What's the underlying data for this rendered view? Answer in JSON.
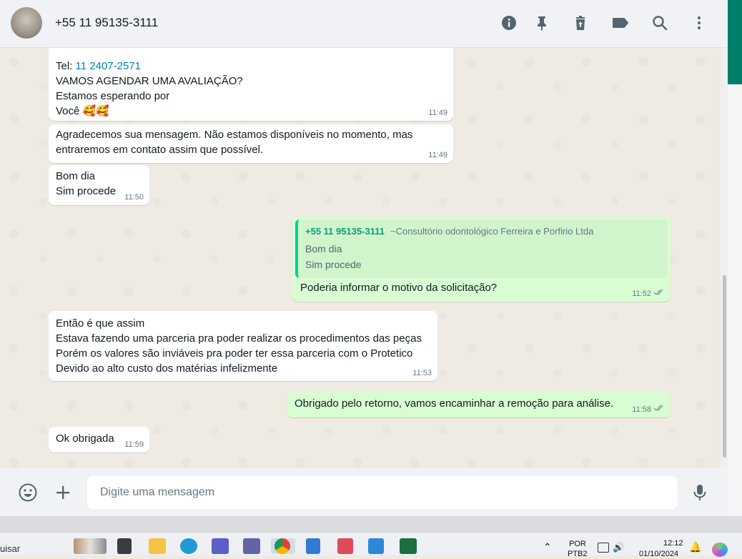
{
  "header": {
    "contact_name": "+55 11 95135-3111",
    "icons": [
      "info-icon",
      "pin-icon",
      "delete-icon",
      "label-icon",
      "search-icon",
      "menu-icon"
    ]
  },
  "messages": [
    {
      "direction": "in",
      "lines": [
        "Tel: ",
        "VAMOS AGENDAR UMA AVALIAÇÃO?",
        "Estamos esperando por",
        "Você 🥰🥰"
      ],
      "phone_link": "11 2407-2571",
      "time": "11:49"
    },
    {
      "direction": "in",
      "lines": [
        "Agradecemos sua mensagem. Não estamos disponíveis no momento, mas",
        "entraremos em contato assim que possível."
      ],
      "time": "11:49"
    },
    {
      "direction": "in",
      "lines": [
        "Bom dia",
        "Sim procede"
      ],
      "time": "11:50"
    },
    {
      "direction": "out",
      "quote": {
        "sender": "+55 11 95135-3111",
        "note": "~Consultório odontológico Ferreira e Porfirio Ltda",
        "lines": [
          "Bom dia",
          "Sim procede"
        ]
      },
      "lines": [
        "Poderia informar o motivo da solicitação?"
      ],
      "time": "11:52"
    },
    {
      "direction": "in",
      "lines": [
        "Então é que assim",
        "Estava fazendo uma parceria pra poder realizar os procedimentos das peças",
        "Porém os valores são inviáveis pra poder ter essa parceria com o Protetico",
        "Devido ao alto custo dos matérias infelizmente"
      ],
      "time": "11:53"
    },
    {
      "direction": "out",
      "lines": [
        "Obrigado pelo retorno, vamos encaminhar a remoção para análise."
      ],
      "time": "11:58"
    },
    {
      "direction": "in",
      "lines": [
        "Ok obrigada"
      ],
      "time": "11:59"
    }
  ],
  "footer": {
    "placeholder": "Digite uma mensagem",
    "icons": [
      "emoji-icon",
      "plus-icon",
      "mic-icon"
    ]
  },
  "taskbar": {
    "search_fragment": "uisar",
    "lang_line1": "POR",
    "lang_line2": "PTB2",
    "clock_time": "12:12",
    "clock_date": "01/10/2024"
  },
  "colors": {
    "chat_bg": "#efeae2",
    "incoming_bubble": "#ffffff",
    "outgoing_bubble": "#d9fdd3",
    "accent_green": "#008069",
    "quote_bar": "#06cf9c",
    "link_blue": "#027eb5",
    "timestamp_gray": "#667781"
  }
}
